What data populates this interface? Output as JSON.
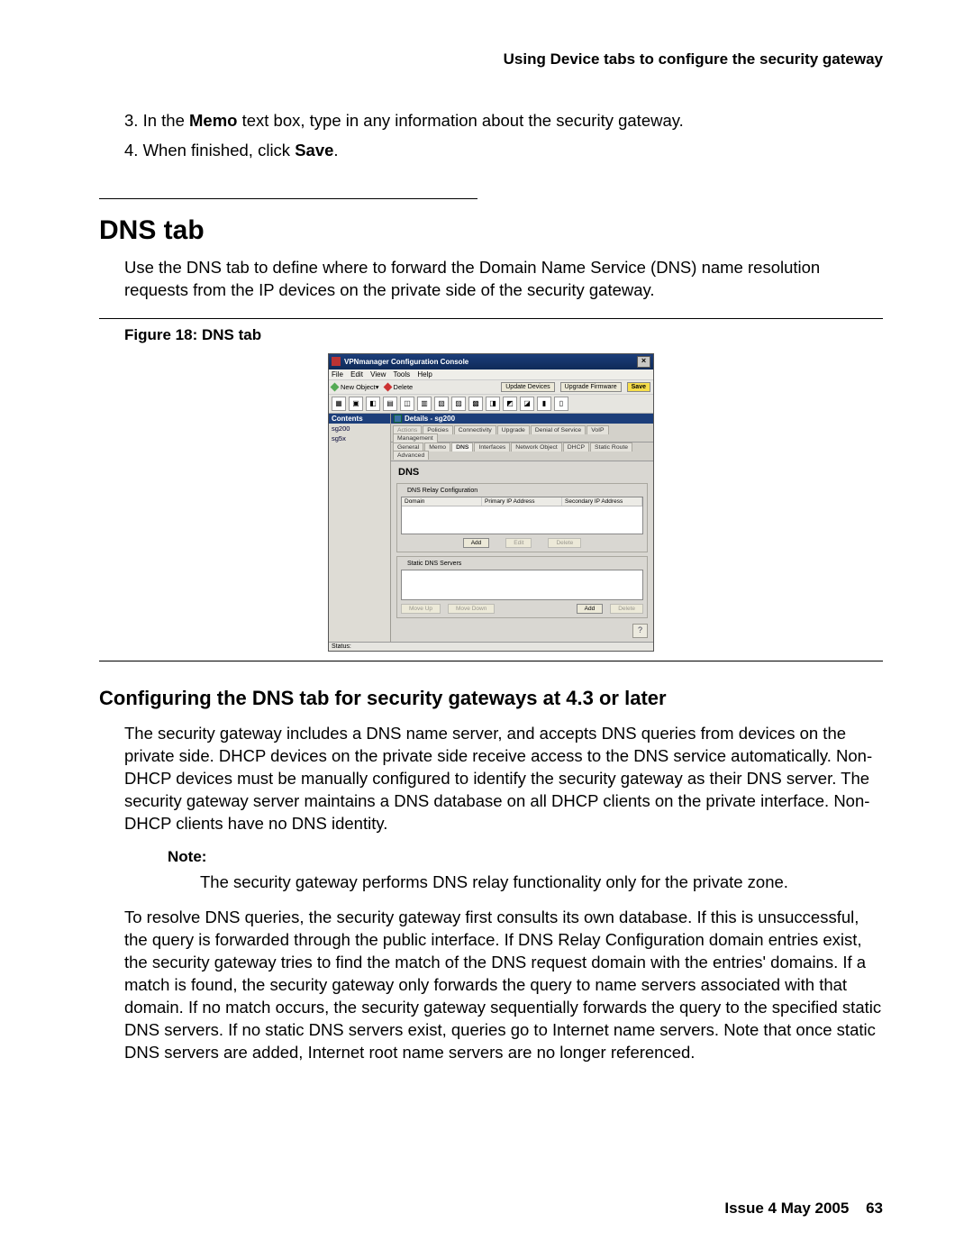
{
  "header": "Using Device tabs to configure the security gateway",
  "steps": {
    "s3_pre": "3. In the ",
    "s3_bold": "Memo",
    "s3_post": " text box, type in any information about the security gateway.",
    "s4_pre": "4. When finished, click ",
    "s4_bold": "Save",
    "s4_post": "."
  },
  "section_title": "DNS tab",
  "intro_text": "Use the DNS tab to define where to forward the Domain Name Service (DNS) name resolution requests from the IP devices on the private side of the security gateway.",
  "figure_caption": "Figure 18: DNS tab",
  "app": {
    "title": "VPNmanager Configuration Console",
    "close_glyph": "×",
    "menus": [
      "File",
      "Edit",
      "View",
      "Tools",
      "Help"
    ],
    "new_object": "New Object",
    "delete": "Delete",
    "update_devices": "Update Devices",
    "upgrade_firmware": "Upgrade Firmware",
    "save": "Save",
    "sidebar_head": "Contents",
    "sidebar_items": [
      "sg200",
      "sg5x"
    ],
    "details_head": "Details - sg200",
    "tabs_row1": [
      "Actions",
      "Policies",
      "Connectivity",
      "Upgrade",
      "Denial of Service",
      "VoIP",
      "Management"
    ],
    "tabs_row2": [
      "General",
      "Memo",
      "DNS",
      "Interfaces",
      "Network Object",
      "DHCP",
      "Static Route",
      "Advanced"
    ],
    "active_tab": "DNS",
    "dns_title": "DNS",
    "fs1_legend": "DNS Relay Configuration",
    "fs1_cols": [
      "Domain",
      "Primary IP Address",
      "Secondary IP Address"
    ],
    "fs1_buttons": {
      "add": "Add",
      "edit": "Edit",
      "delete": "Delete"
    },
    "fs2_legend": "Static DNS Servers",
    "fs2_buttons": {
      "moveup": "Move Up",
      "movedown": "Move Down",
      "add": "Add",
      "delete": "Delete"
    },
    "help_glyph": "?",
    "statusbar": "Status:"
  },
  "subsection_title": "Configuring the DNS tab for security gateways at 4.3 or later",
  "para1": "The security gateway includes a DNS name server, and accepts DNS queries from devices on the private side. DHCP devices on the private side receive access to the DNS service automatically. Non-DHCP devices must be manually configured to identify the security gateway as their DNS server. The security gateway server maintains a DNS database on all DHCP clients on the private interface. Non-DHCP clients have no DNS identity.",
  "note_label": "Note:",
  "note_body": "The security gateway performs DNS relay functionality only for the private zone.",
  "para2": "To resolve DNS queries, the security gateway first consults its own database. If this is unsuccessful, the query is forwarded through the public interface. If DNS Relay Configuration domain entries exist, the security gateway tries to find the match of the DNS request domain with the entries' domains. If a match is found, the security gateway only forwards the query to name servers associated with that domain. If no match occurs, the security gateway sequentially forwards the query to the specified static DNS servers. If no static DNS servers exist, queries go to Internet name servers. Note that once static DNS servers are added, Internet root name servers are no longer referenced.",
  "footer_issue": "Issue 4   May 2005",
  "footer_page": "63"
}
